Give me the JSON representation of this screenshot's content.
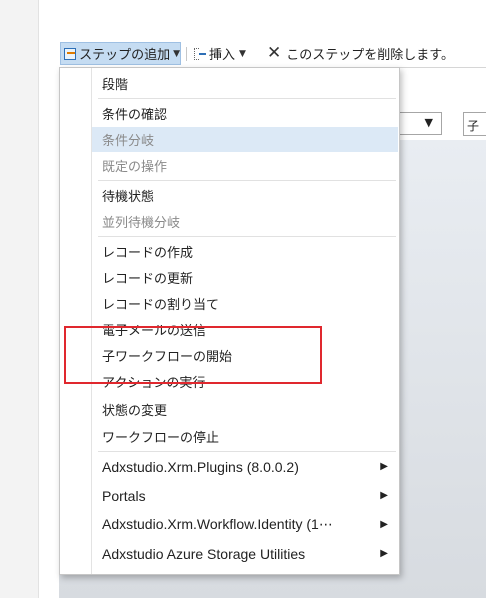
{
  "toolbar": {
    "add_step_label": "ステップの追加",
    "insert_label": "挿入",
    "delete_label": "このステップを削除します。"
  },
  "form": {
    "field_value": "子"
  },
  "menu": {
    "items": [
      {
        "label": "段階",
        "state": "enabled"
      },
      {
        "label": "条件の確認",
        "state": "enabled"
      },
      {
        "label": "条件分岐",
        "state": "disabled-hover"
      },
      {
        "label": "既定の操作",
        "state": "disabled"
      },
      {
        "label": "待機状態",
        "state": "enabled"
      },
      {
        "label": "並列待機分岐",
        "state": "disabled"
      },
      {
        "label": "レコードの作成",
        "state": "enabled"
      },
      {
        "label": "レコードの更新",
        "state": "enabled"
      },
      {
        "label": "レコードの割り当て",
        "state": "enabled"
      },
      {
        "label": "電子メールの送信",
        "state": "enabled"
      },
      {
        "label": "子ワークフローの開始",
        "state": "enabled"
      },
      {
        "label": "アクションの実行",
        "state": "enabled"
      },
      {
        "label": "状態の変更",
        "state": "enabled"
      },
      {
        "label": "ワークフローの停止",
        "state": "enabled"
      },
      {
        "label": "Adxstudio.Xrm.Plugins (8.0.0.2)",
        "state": "submenu"
      },
      {
        "label": "Portals",
        "state": "submenu"
      },
      {
        "label": "Adxstudio.Xrm.Workflow.Identity (1⋯",
        "state": "submenu"
      },
      {
        "label": "Adxstudio Azure Storage Utilities",
        "state": "submenu"
      }
    ]
  },
  "colors": {
    "highlight_border": "#e0282e",
    "hover_bg": "#dce9f6",
    "selected_button_bg": "#c5dcf2"
  }
}
